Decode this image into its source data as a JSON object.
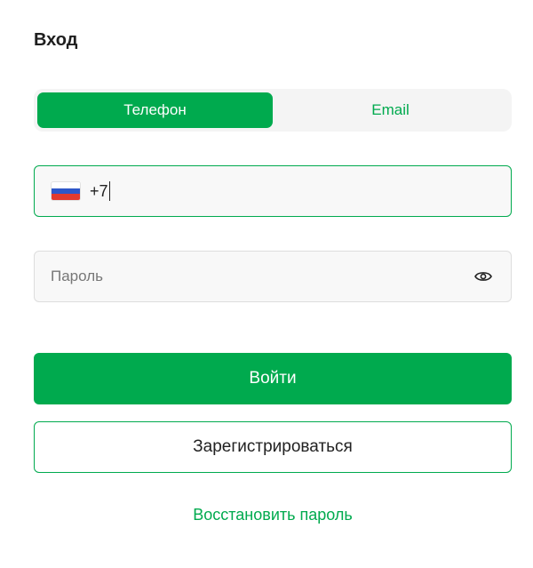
{
  "page": {
    "title": "Вход"
  },
  "tabs": [
    {
      "label": "Телефон",
      "active": true
    },
    {
      "label": "Email",
      "active": false
    }
  ],
  "phone": {
    "country_flag": "ru-flag-icon",
    "value": "+7"
  },
  "password": {
    "placeholder": "Пароль",
    "toggle_icon": "eye-icon"
  },
  "actions": {
    "login_label": "Войти",
    "register_label": "Зарегистрироваться",
    "restore_label": "Восстановить пароль"
  },
  "colors": {
    "accent": "#00aa4e",
    "field_bg": "#f8f8f8",
    "tabs_bg": "#f4f4f4"
  }
}
